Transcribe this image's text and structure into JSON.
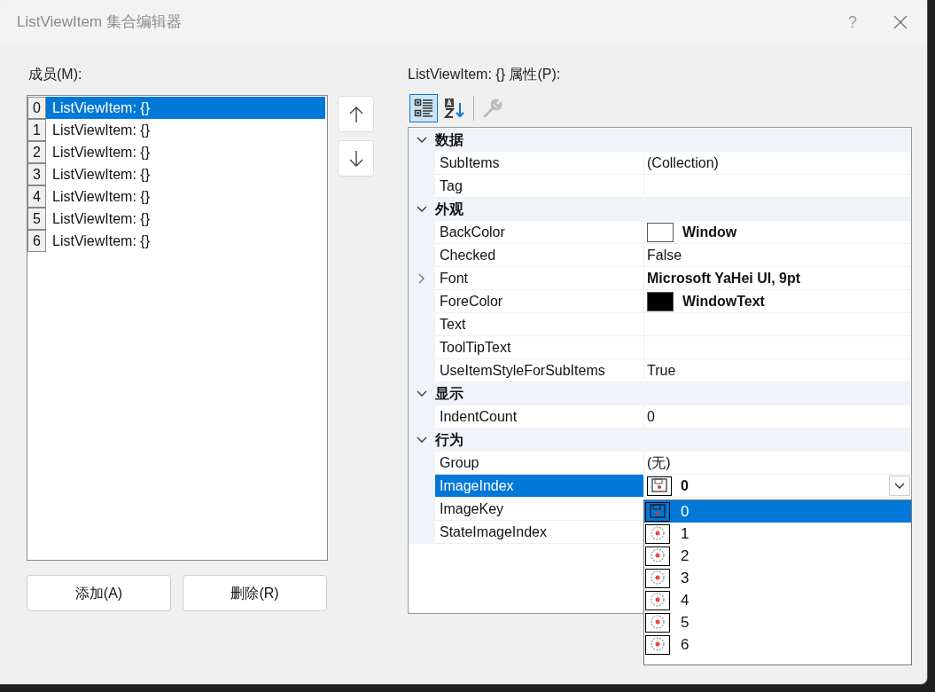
{
  "window": {
    "title": "ListViewItem 集合编辑器",
    "help": "?"
  },
  "members": {
    "label": "成员(M):",
    "items": [
      {
        "index": "0",
        "text": "ListViewItem: {}",
        "selected": true
      },
      {
        "index": "1",
        "text": "ListViewItem: {}",
        "selected": false
      },
      {
        "index": "2",
        "text": "ListViewItem: {}",
        "selected": false
      },
      {
        "index": "3",
        "text": "ListViewItem: {}",
        "selected": false
      },
      {
        "index": "4",
        "text": "ListViewItem: {}",
        "selected": false
      },
      {
        "index": "5",
        "text": "ListViewItem: {}",
        "selected": false
      },
      {
        "index": "6",
        "text": "ListViewItem: {}",
        "selected": false
      }
    ]
  },
  "buttons": [
    "添加(A)",
    "删除(R)"
  ],
  "properties": {
    "label": "ListViewItem: {} 属性(P):",
    "toolbar": [
      {
        "kind": "categorized",
        "selected": true,
        "disabled": false
      },
      {
        "kind": "alphabetical",
        "selected": false,
        "disabled": false
      },
      {
        "kind": "property_pages",
        "selected": false,
        "disabled": true
      }
    ],
    "categories": [
      {
        "name": "数据",
        "expanded": true,
        "items": [
          {
            "name": "SubItems",
            "value": "(Collection)",
            "bold": false,
            "expandable": false,
            "selected": false
          },
          {
            "name": "Tag",
            "value": "",
            "expandable": false,
            "selected": false
          }
        ]
      },
      {
        "name": "外观",
        "expanded": true,
        "items": [
          {
            "name": "BackColor",
            "value": "Window",
            "bold": true,
            "color": "#ffffff",
            "expandable": false,
            "selected": false
          },
          {
            "name": "Checked",
            "value": "False",
            "bold": false,
            "expandable": false,
            "selected": false
          },
          {
            "name": "Font",
            "value": "Microsoft YaHei UI, 9pt",
            "bold": true,
            "expandable": true,
            "selected": false
          },
          {
            "name": "ForeColor",
            "value": "WindowText",
            "bold": true,
            "color": "#000000",
            "expandable": false,
            "selected": false
          },
          {
            "name": "Text",
            "value": "",
            "expandable": false,
            "selected": false
          },
          {
            "name": "ToolTipText",
            "value": "",
            "expandable": false,
            "selected": false
          },
          {
            "name": "UseItemStyleForSubItems",
            "value": "True",
            "bold": false,
            "expandable": false,
            "selected": false
          }
        ]
      },
      {
        "name": "显示",
        "expanded": true,
        "items": [
          {
            "name": "IndentCount",
            "value": "0",
            "bold": false,
            "expandable": false,
            "selected": false
          }
        ]
      },
      {
        "name": "行为",
        "expanded": true,
        "items": [
          {
            "name": "Group",
            "value": "(无)",
            "bold": false,
            "expandable": false,
            "selected": false
          },
          {
            "name": "ImageIndex",
            "value": "0",
            "bold": true,
            "image": true,
            "expandable": false,
            "selected": true
          },
          {
            "name": "ImageKey",
            "value": "",
            "expandable": false,
            "selected": false
          },
          {
            "name": "StateImageIndex",
            "value": "",
            "expandable": false,
            "selected": false
          }
        ]
      }
    ]
  },
  "dropdown": {
    "items": [
      {
        "text": "0",
        "selected": true
      },
      {
        "text": "1",
        "selected": false
      },
      {
        "text": "2",
        "selected": false
      },
      {
        "text": "3",
        "selected": false
      },
      {
        "text": "4",
        "selected": false
      },
      {
        "text": "5",
        "selected": false
      },
      {
        "text": "6",
        "selected": false
      }
    ]
  }
}
